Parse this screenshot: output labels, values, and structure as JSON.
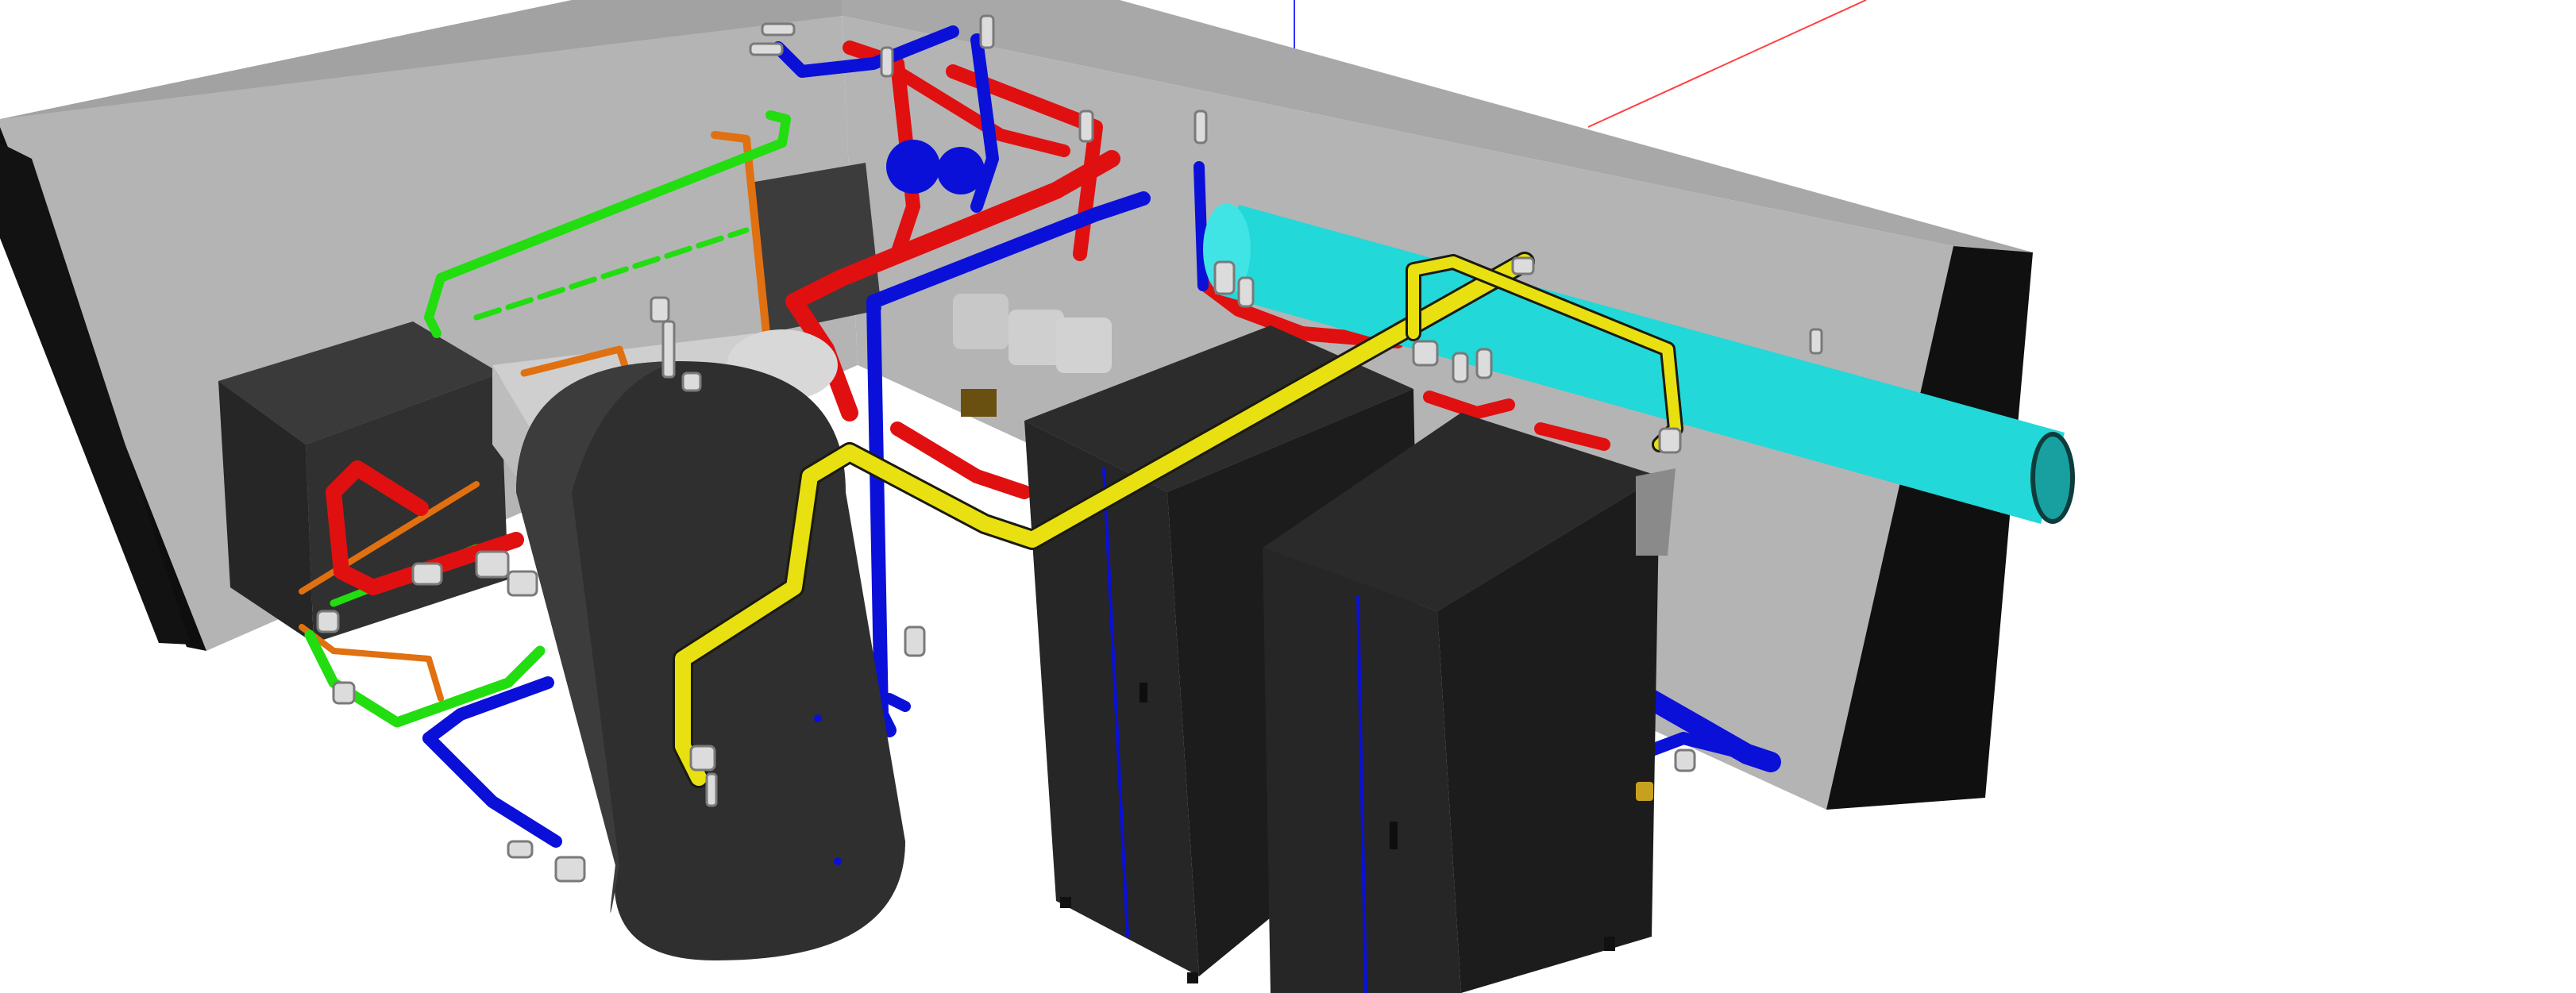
{
  "viewport": {
    "label": "",
    "background_color": "#ffffff"
  },
  "scene": {
    "description_label": "",
    "colors": {
      "wall_face": "#b4b4b4",
      "wall_top": "#9c9c9c",
      "wall_edge": "#0e0e0e",
      "floor_shadow": "#d4d4d4",
      "equipment_dark": "#2a2a2a",
      "equipment_mid": "#3a3a3a",
      "equipment_light": "#4a4a4a",
      "pipe_red": "#e01010",
      "pipe_blue": "#0a10d8",
      "pipe_green": "#22dd10",
      "pipe_orange": "#e07010",
      "pipe_yellow": "#e8e010",
      "pipe_cyan": "#22d8d8",
      "fittings": "#dcdcdc",
      "axis_blue": "#3030ff",
      "axis_red": "#ff4040"
    },
    "objects": [
      {
        "name": "back-wall-left",
        "kind": "wall"
      },
      {
        "name": "back-wall-right",
        "kind": "wall"
      },
      {
        "name": "storage-tank",
        "kind": "cylinder-tank"
      },
      {
        "name": "boiler-cabinet-left",
        "kind": "cabinet"
      },
      {
        "name": "boiler-cabinet-right",
        "kind": "cabinet"
      },
      {
        "name": "small-unit-left",
        "kind": "box"
      },
      {
        "name": "cyan-header-pipe",
        "kind": "pipe"
      },
      {
        "name": "yellow-pipe",
        "kind": "pipe"
      },
      {
        "name": "red-pipes",
        "kind": "pipe"
      },
      {
        "name": "blue-pipes",
        "kind": "pipe"
      },
      {
        "name": "green-pipe",
        "kind": "pipe"
      },
      {
        "name": "orange-pipe",
        "kind": "pipe"
      },
      {
        "name": "pump-group",
        "kind": "pumps"
      }
    ]
  }
}
